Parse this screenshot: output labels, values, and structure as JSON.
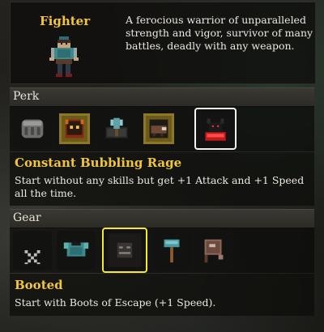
{
  "character": {
    "name": "Fighter",
    "description": "A ferocious warrior of unparalleled strength and vigor, survivor of many battles, deadly with any weapon."
  },
  "perk": {
    "section_label": "Perk",
    "slots": [
      {
        "icon": "gauntlet-fist-icon",
        "selected": false
      },
      {
        "icon": "rage-demon-icon",
        "selected": false
      },
      {
        "icon": "battle-axe-chest-icon",
        "selected": false
      },
      {
        "icon": "charging-boar-icon",
        "selected": false
      },
      {
        "icon": "bubbling-rage-icon",
        "selected": true
      }
    ],
    "selected_title": "Constant Bubbling Rage",
    "selected_description": "Start without any skills but get +1 Attack and +1 Speed all the time."
  },
  "gear": {
    "section_label": "Gear",
    "slots": [
      {
        "icon": "none-x-icon",
        "selected": false
      },
      {
        "icon": "chest-armor-icon",
        "selected": false
      },
      {
        "icon": "boots-icon",
        "selected": true
      },
      {
        "icon": "hammer-icon",
        "selected": false
      },
      {
        "icon": "scroll-banner-icon",
        "selected": false
      }
    ],
    "selected_title": "Booted",
    "selected_description": "Start with Boots of Escape (+1 Speed)."
  },
  "colors": {
    "accent_title": "#f2c53d",
    "selected_perk_border": "#f4f4f4",
    "selected_gear_border": "#f4e63c"
  }
}
